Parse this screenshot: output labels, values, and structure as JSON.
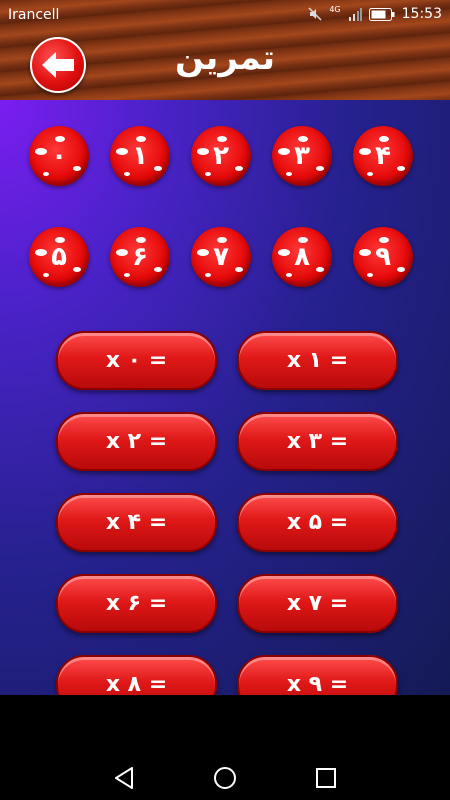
{
  "status": {
    "carrier": "Irancell",
    "network": "4G",
    "time": "15:53"
  },
  "header": {
    "title": "تمرین",
    "back_icon": "back-arrow-icon"
  },
  "digits": [
    "۰",
    "۱",
    "۲",
    "۳",
    "۴",
    "۵",
    "۶",
    "۷",
    "۸",
    "۹"
  ],
  "tables": [
    {
      "label": "x ۰ ="
    },
    {
      "label": "x ۱ ="
    },
    {
      "label": "x ۲ ="
    },
    {
      "label": "x ۳ ="
    },
    {
      "label": "x ۴ ="
    },
    {
      "label": "x ۵ ="
    },
    {
      "label": "x ۶ ="
    },
    {
      "label": "x ۷ ="
    },
    {
      "label": "x ۸ ="
    },
    {
      "label": "x ۹ ="
    }
  ],
  "nav": {
    "back": "back-icon",
    "home": "home-icon",
    "recents": "recents-icon"
  },
  "colors": {
    "accent": "#e60a0a",
    "background": "#26218f",
    "header": "#8b3a16"
  }
}
